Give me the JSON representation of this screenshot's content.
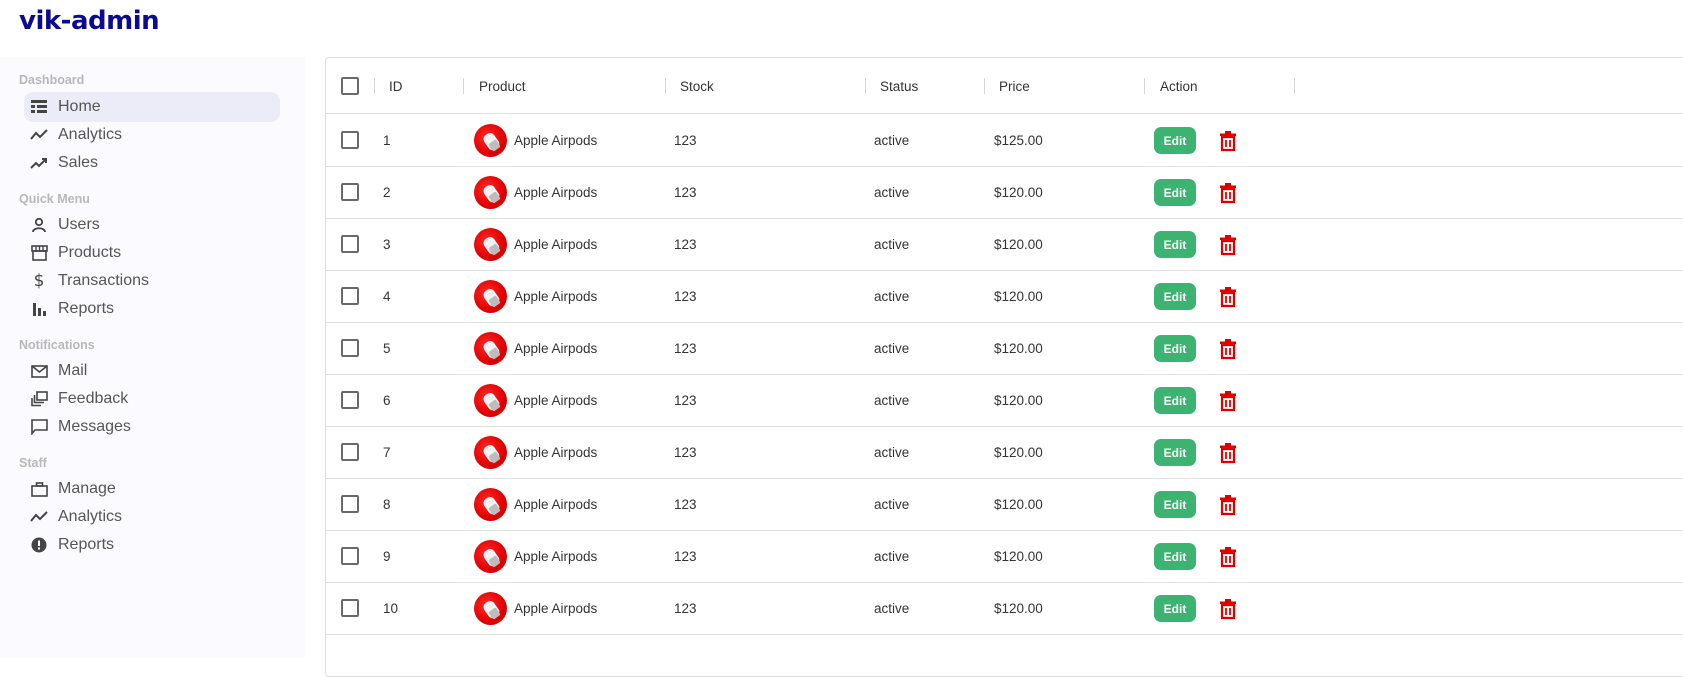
{
  "app": {
    "title": "vik-admin"
  },
  "sidebar": {
    "sections": [
      {
        "title": "Dashboard",
        "items": [
          {
            "label": "Home",
            "icon": "home-table-icon",
            "active": true
          },
          {
            "label": "Analytics",
            "icon": "timeline-icon"
          },
          {
            "label": "Sales",
            "icon": "trending-up-icon"
          }
        ]
      },
      {
        "title": "Quick Menu",
        "items": [
          {
            "label": "Users",
            "icon": "person-icon"
          },
          {
            "label": "Products",
            "icon": "storefront-icon"
          },
          {
            "label": "Transactions",
            "icon": "dollar-icon"
          },
          {
            "label": "Reports",
            "icon": "bar-chart-icon"
          }
        ]
      },
      {
        "title": "Notifications",
        "items": [
          {
            "label": "Mail",
            "icon": "mail-icon"
          },
          {
            "label": "Feedback",
            "icon": "dynamic-feed-icon"
          },
          {
            "label": "Messages",
            "icon": "chat-bubble-icon"
          }
        ]
      },
      {
        "title": "Staff",
        "items": [
          {
            "label": "Manage",
            "icon": "briefcase-icon"
          },
          {
            "label": "Analytics",
            "icon": "timeline-icon"
          },
          {
            "label": "Reports",
            "icon": "error-icon"
          }
        ]
      }
    ]
  },
  "table": {
    "columns": [
      "ID",
      "Product",
      "Stock",
      "Status",
      "Price",
      "Action"
    ],
    "edit_label": "Edit",
    "rows": [
      {
        "id": "1",
        "product": "Apple Airpods",
        "stock": "123",
        "status": "active",
        "price": "$125.00"
      },
      {
        "id": "2",
        "product": "Apple Airpods",
        "stock": "123",
        "status": "active",
        "price": "$120.00"
      },
      {
        "id": "3",
        "product": "Apple Airpods",
        "stock": "123",
        "status": "active",
        "price": "$120.00"
      },
      {
        "id": "4",
        "product": "Apple Airpods",
        "stock": "123",
        "status": "active",
        "price": "$120.00"
      },
      {
        "id": "5",
        "product": "Apple Airpods",
        "stock": "123",
        "status": "active",
        "price": "$120.00"
      },
      {
        "id": "6",
        "product": "Apple Airpods",
        "stock": "123",
        "status": "active",
        "price": "$120.00"
      },
      {
        "id": "7",
        "product": "Apple Airpods",
        "stock": "123",
        "status": "active",
        "price": "$120.00"
      },
      {
        "id": "8",
        "product": "Apple Airpods",
        "stock": "123",
        "status": "active",
        "price": "$120.00"
      },
      {
        "id": "9",
        "product": "Apple Airpods",
        "stock": "123",
        "status": "active",
        "price": "$120.00"
      },
      {
        "id": "10",
        "product": "Apple Airpods",
        "stock": "123",
        "status": "active",
        "price": "$120.00"
      }
    ]
  },
  "colors": {
    "brand": "#0b0b8f",
    "edit": "#3cb371",
    "delete": "#e00000",
    "active_item": "#ececf8"
  }
}
